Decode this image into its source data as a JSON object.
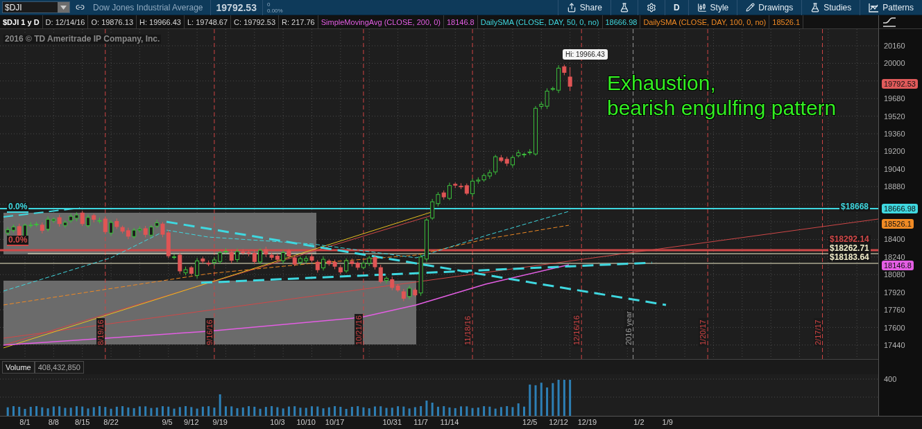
{
  "toolbar": {
    "symbol": "$DJI",
    "description": "Dow Jones Industrial Average",
    "last": "19792.53",
    "change": "0",
    "change_percent": "0.00%",
    "buttons": [
      {
        "label": "Share",
        "kind": "share"
      },
      {
        "kind": "flask"
      },
      {
        "kind": "gear"
      },
      {
        "label": "D",
        "kind": "text"
      },
      {
        "label": "Style",
        "kind": "style"
      },
      {
        "label": "Drawings",
        "kind": "pencil"
      },
      {
        "label": "Studies",
        "kind": "flask"
      },
      {
        "label": "Patterns",
        "kind": "patterns"
      }
    ]
  },
  "info_bar": {
    "title": "$DJI 1 y D",
    "fields": [
      "D: 12/14/16",
      "O: 19876.13",
      "H: 19966.43",
      "L: 19748.67",
      "C: 19792.53",
      "R: 217.76"
    ],
    "studies": [
      {
        "name": "SimpleMovingAvg (CLOSE, 200, 0)",
        "value": "18146.8",
        "color": "#e45ee4"
      },
      {
        "name": "DailySMA (CLOSE, DAY, 50, 0, no)",
        "value": "18666.98",
        "color": "#3fd8e0"
      },
      {
        "name": "DailySMA (CLOSE, DAY, 100, 0, no)",
        "value": "18526.1",
        "color": "#f08a24"
      }
    ]
  },
  "chart": {
    "copyright": "2016 © TD Ameritrade IP Company, Inc.",
    "fib_labels": [
      {
        "text": "0.0%",
        "color": "#3fd8e0"
      },
      {
        "text": "0.0%",
        "color": "#d04848"
      }
    ],
    "level_labels": [
      {
        "text": "$18668",
        "color": "#3fd8e0"
      },
      {
        "text": "$18292.14",
        "color": "#d04848"
      },
      {
        "text": "$18262.71",
        "color": "#f2eecb"
      },
      {
        "text": "$18183.64",
        "color": "#f2eecb"
      }
    ],
    "date_markers": [
      {
        "label": "8/19/16",
        "kind": "expiry"
      },
      {
        "label": "9/16/16",
        "kind": "expiry"
      },
      {
        "label": "10/21/16",
        "kind": "expiry"
      },
      {
        "label": "11/18/16",
        "kind": "expiry"
      },
      {
        "label": "12/16/16",
        "kind": "expiry"
      },
      {
        "label": "2016 year",
        "kind": "year"
      },
      {
        "label": "1/20/17",
        "kind": "expiry"
      },
      {
        "label": "2/17/17",
        "kind": "expiry"
      }
    ],
    "high_callout": "Hi: 19966.43",
    "annotation": [
      "Exhaustion,",
      "bearish engulfing pattern"
    ],
    "price_ticks": [
      "20160",
      "20000",
      "19680",
      "19520",
      "19360",
      "19200",
      "19040",
      "18880",
      "18400",
      "18240",
      "18080",
      "17920",
      "17760",
      "17600",
      "17440"
    ],
    "price_badges": [
      {
        "value": "19792.53",
        "color": "#e05a5a"
      },
      {
        "value": "18666.98",
        "color": "#3fd8e0"
      },
      {
        "value": "18526.1",
        "color": "#f08a24"
      },
      {
        "value": "18146.8",
        "color": "#e45ee4"
      }
    ]
  },
  "volume": {
    "title": "Volume",
    "value": "408,432,850",
    "ticks": [
      "400"
    ]
  },
  "time_axis": {
    "labels": [
      "8/1",
      "8/8",
      "8/15",
      "8/22",
      "9/5",
      "9/12",
      "9/19",
      "10/3",
      "10/10",
      "10/17",
      "10/31",
      "11/7",
      "11/14",
      "12/5",
      "12/12",
      "12/19",
      "1/2",
      "1/9"
    ]
  }
}
